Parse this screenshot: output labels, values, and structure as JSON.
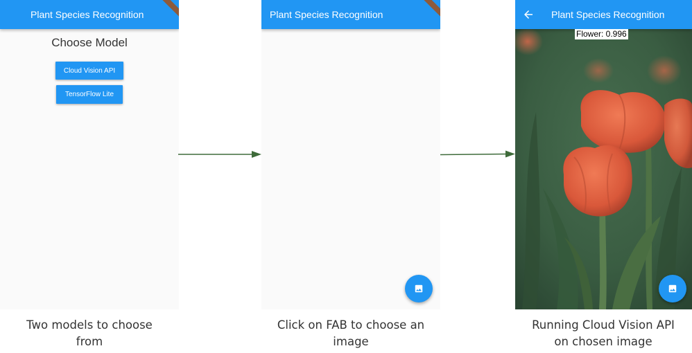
{
  "screens": {
    "choose_model": {
      "appbar_title": "Plant Species Recognition",
      "heading": "Choose Model",
      "buttons": {
        "cloud_vision": "Cloud Vision API",
        "tflite": "TensorFlow Lite"
      }
    },
    "pick_image": {
      "appbar_title": "Plant Species Recognition",
      "fab_icon": "image-icon"
    },
    "result": {
      "appbar_title": "Plant Species Recognition",
      "back_icon": "arrow-left-icon",
      "result_label": "Flower: 0.996",
      "fab_icon": "image-icon"
    }
  },
  "captions": {
    "step1": "Two models to choose from",
    "step2": "Click on FAB to choose an image",
    "step3": "Running Cloud Vision API on chosen image"
  },
  "colors": {
    "appbar": "#2196f3",
    "arrow": "#3e6b3a",
    "debug_banner": "#8d5a3b"
  }
}
